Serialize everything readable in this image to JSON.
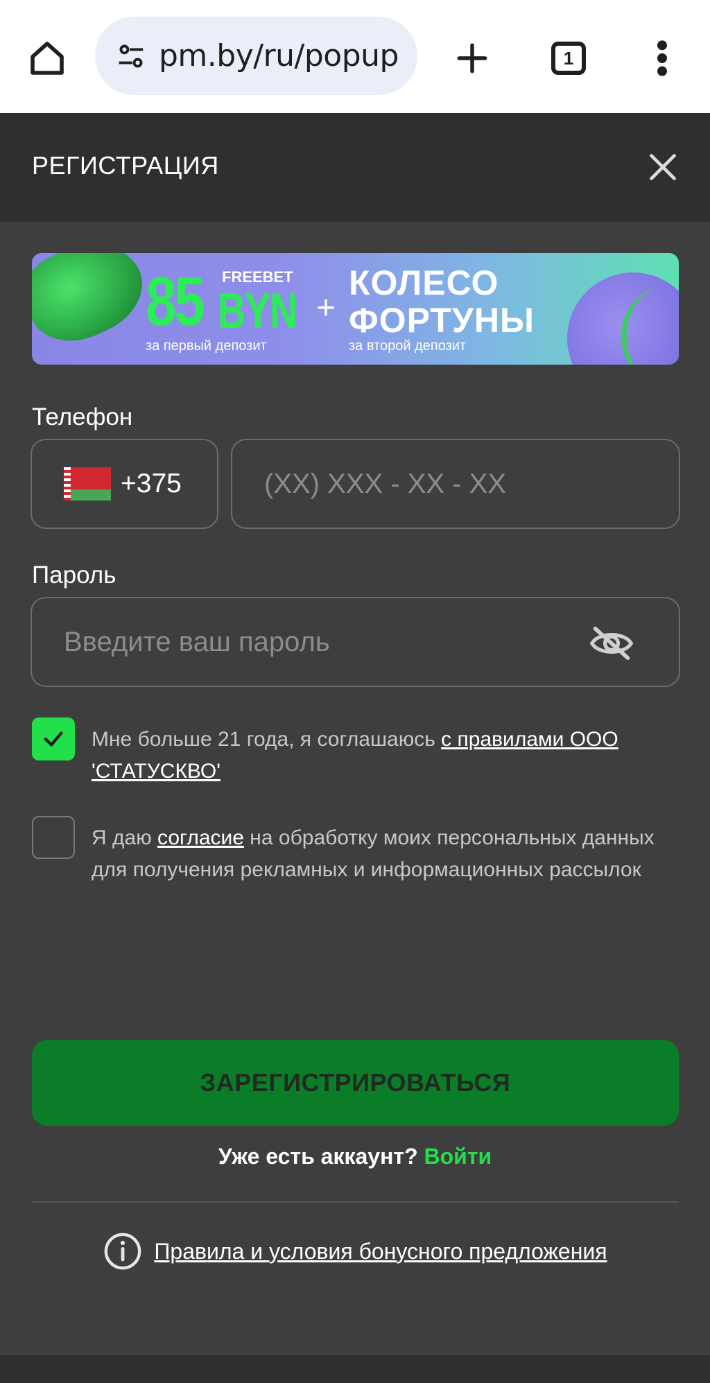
{
  "browser": {
    "url": "pm.by/ru/popup",
    "tab_count": "1"
  },
  "modal": {
    "title": "РЕГИСТРАЦИЯ"
  },
  "banner": {
    "amount": "85",
    "currency": "BYN",
    "freebet": "FREEBET",
    "first_sub": "за первый депозит",
    "plus": "+",
    "line1": "КОЛЕСО",
    "line2": "ФОРТУНЫ",
    "second_sub": "за второй депозит"
  },
  "form": {
    "phone_label": "Телефон",
    "dial_code": "+375",
    "phone_placeholder": "(XX) XXX - XX - XX",
    "password_label": "Пароль",
    "password_placeholder": "Введите ваш пароль",
    "age_checkbox": {
      "checked": true,
      "text": "Мне больше 21 года, я соглашаюсь ",
      "link": "с правилами ООО 'СТАТУСКВО'"
    },
    "consent_checkbox": {
      "checked": false,
      "text_before": "Я даю ",
      "link": "согласие",
      "text_after": " на обработку моих персональных данных для получения рекламных и информационных рассылок"
    },
    "submit_label": "ЗАРЕГИСТРИРОВАТЬСЯ",
    "have_account": "Уже есть аккаунт? ",
    "login_link": "Войти",
    "rules_link": "Правила и условия бонусного предложения"
  },
  "colors": {
    "accent_green": "#22e04a",
    "button_green": "#0b7d28",
    "background": "#3e3e3e"
  },
  "icons": [
    "home-icon",
    "tune-icon",
    "plus-icon",
    "tabs-icon",
    "more-vert-icon",
    "close-icon",
    "eye-off-icon",
    "check-icon",
    "info-icon",
    "flag-by-icon"
  ]
}
